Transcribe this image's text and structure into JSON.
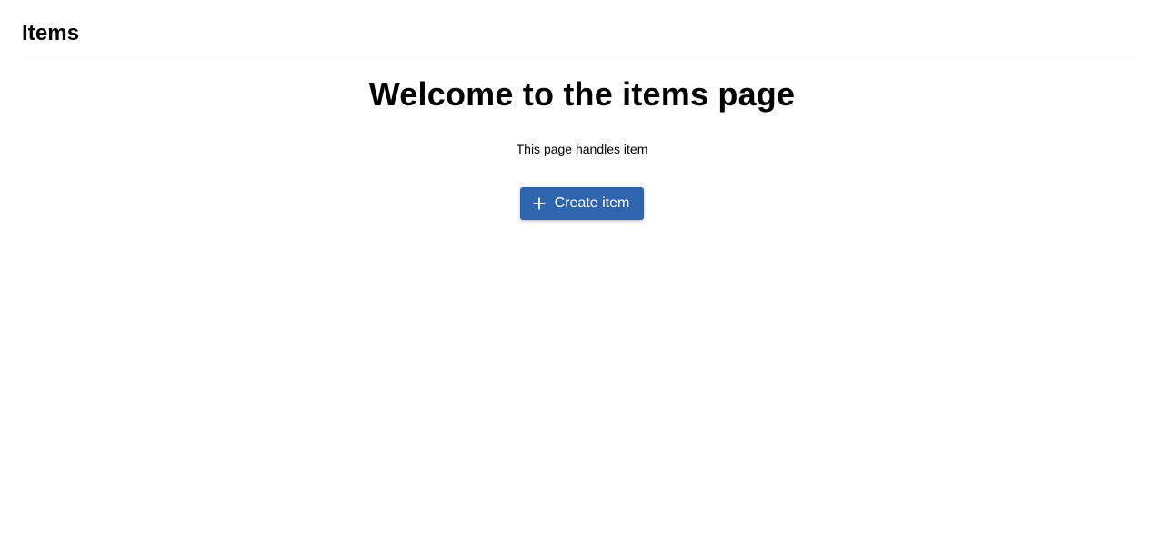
{
  "header": {
    "title": "Items"
  },
  "main": {
    "heading": "Welcome to the items page",
    "description": "This page handles item",
    "create_button": {
      "label": "Create item",
      "icon": "plus-icon"
    }
  },
  "colors": {
    "accent": "#2e65ac",
    "divider": "#3a3a3a"
  }
}
